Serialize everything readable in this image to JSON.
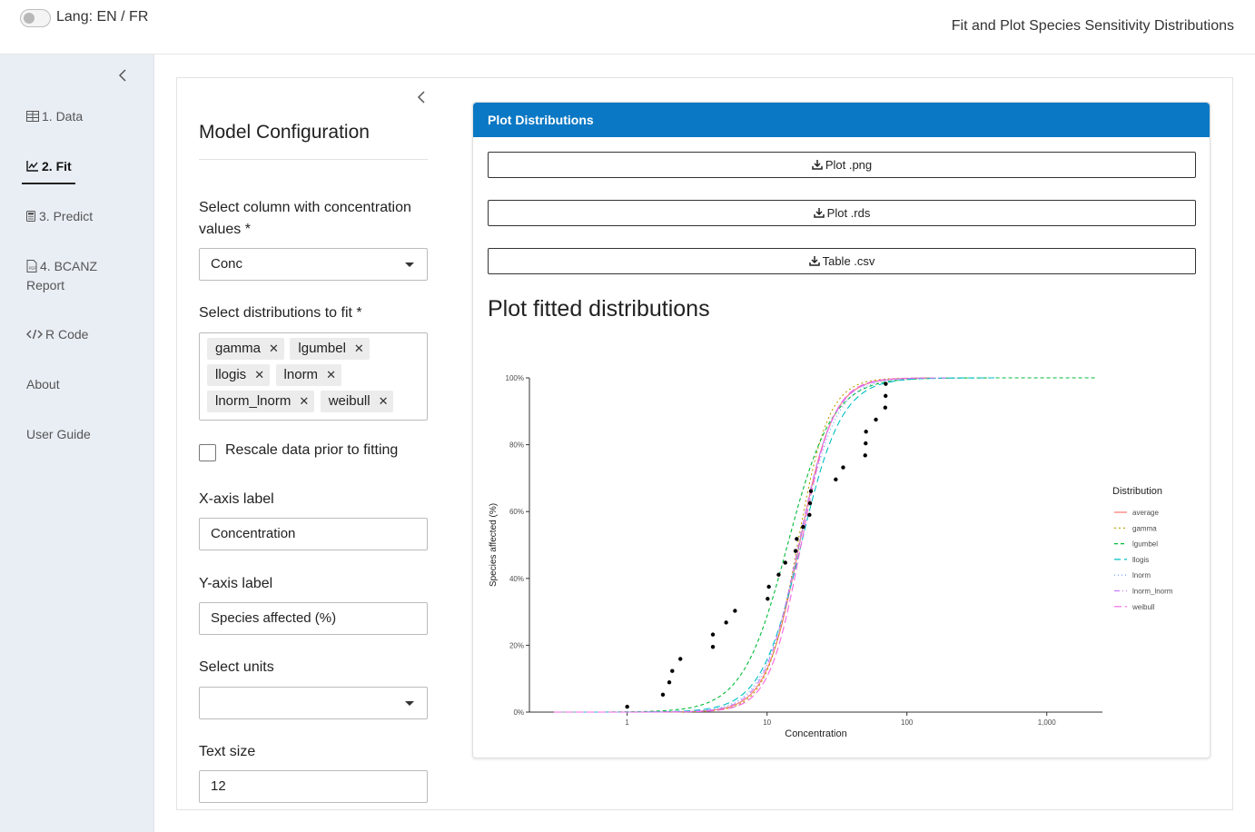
{
  "header": {
    "lang_label": "Lang: EN / FR",
    "app_title": "Fit and Plot Species Sensitivity Distributions"
  },
  "sidebar": {
    "collapse_icon": "chevron-left-icon",
    "items": [
      {
        "label": "1. Data",
        "icon": "table-icon",
        "active": false
      },
      {
        "label": "2. Fit",
        "icon": "chart-line-icon",
        "active": true
      },
      {
        "label": "3. Predict",
        "icon": "calculator-icon",
        "active": false
      },
      {
        "label": "4. BCANZ",
        "label2": "Report",
        "icon": "file-pdf-icon",
        "active": false
      },
      {
        "label": "R Code",
        "icon": "code-icon",
        "active": false
      },
      {
        "label": "About",
        "icon": "",
        "active": false
      },
      {
        "label": "User Guide",
        "icon": "",
        "active": false
      }
    ]
  },
  "config": {
    "title": "Model Configuration",
    "conc_label": "Select column with concentration values *",
    "conc_value": "Conc",
    "dists_label": "Select distributions to fit *",
    "dists": [
      "gamma",
      "lgumbel",
      "llogis",
      "lnorm",
      "lnorm_lnorm",
      "weibull"
    ],
    "rescale_label": "Rescale data prior to fitting",
    "rescale_checked": false,
    "xlab_label": "X-axis label",
    "xlab_value": "Concentration",
    "ylab_label": "Y-axis label",
    "ylab_value": "Species affected (%)",
    "units_label": "Select units",
    "units_value": "",
    "textsize_label": "Text size",
    "textsize_value": "12"
  },
  "plot_card": {
    "header": "Plot Distributions",
    "btn_png": "Plot .png",
    "btn_rds": "Plot .rds",
    "btn_csv": "Table .csv",
    "heading": "Plot fitted distributions"
  },
  "chart_data": {
    "type": "line",
    "xlabel": "Concentration",
    "ylabel": "Species affected (%)",
    "x_scale": "log10",
    "xlim": [
      0.2,
      2500
    ],
    "ylim": [
      0,
      100
    ],
    "x_ticks": [
      1,
      10,
      100,
      1000
    ],
    "x_tick_labels": [
      "1",
      "10",
      "100",
      "1,000"
    ],
    "y_ticks": [
      0,
      20,
      40,
      60,
      80,
      100
    ],
    "y_tick_labels": [
      "0%",
      "20%",
      "40%",
      "60%",
      "80%",
      "100%"
    ],
    "legend_title": "Distribution",
    "legend_position": "right",
    "series": [
      {
        "name": "average",
        "color": "#f8766d",
        "dash": "",
        "median": 17.0,
        "slope": 3.6,
        "xmin": 0.3,
        "xmax": 155
      },
      {
        "name": "gamma",
        "color": "#b79f00",
        "dash": "2,3",
        "median": 16.5,
        "slope": 3.9,
        "xmin": 0.3,
        "xmax": 145
      },
      {
        "name": "lgumbel",
        "color": "#00ba38",
        "dash": "4,3",
        "median": 14.0,
        "slope": 2.7,
        "xmin": 0.7,
        "xmax": 2300
      },
      {
        "name": "llogis",
        "color": "#00bfc4",
        "dash": "7,4",
        "median": 17.5,
        "slope": 3.0,
        "xmin": 0.3,
        "xmax": 450
      },
      {
        "name": "lnorm",
        "color": "#619cff",
        "dash": "1,3",
        "median": 17.0,
        "slope": 3.3,
        "xmin": 0.3,
        "xmax": 230
      },
      {
        "name": "lnorm_lnorm",
        "color": "#c77cff",
        "dash": "6,3,1,3",
        "median": 16.8,
        "slope": 3.5,
        "xmin": 0.3,
        "xmax": 190
      },
      {
        "name": "weibull",
        "color": "#f564e3",
        "dash": "8,4",
        "median": 17.5,
        "slope": 3.8,
        "xmin": 0.3,
        "xmax": 135
      }
    ],
    "points": [
      [
        1.0,
        1.6
      ],
      [
        1.8,
        5.2
      ],
      [
        2.0,
        8.9
      ],
      [
        2.1,
        12.3
      ],
      [
        2.4,
        15.9
      ],
      [
        4.1,
        19.5
      ],
      [
        4.1,
        23.2
      ],
      [
        5.1,
        26.8
      ],
      [
        5.9,
        30.3
      ],
      [
        10.1,
        33.9
      ],
      [
        10.3,
        37.5
      ],
      [
        12.1,
        41.1
      ],
      [
        13.5,
        44.7
      ],
      [
        16.0,
        48.2
      ],
      [
        16.3,
        51.8
      ],
      [
        18.1,
        55.4
      ],
      [
        20.1,
        59.0
      ],
      [
        20.3,
        62.5
      ],
      [
        20.6,
        66.1
      ],
      [
        31.0,
        69.6
      ],
      [
        35.0,
        73.2
      ],
      [
        50.3,
        76.8
      ],
      [
        50.7,
        80.4
      ],
      [
        51.0,
        83.9
      ],
      [
        60.0,
        87.5
      ],
      [
        70.0,
        91.1
      ],
      [
        70.4,
        94.6
      ],
      [
        70.6,
        98.2
      ]
    ]
  }
}
